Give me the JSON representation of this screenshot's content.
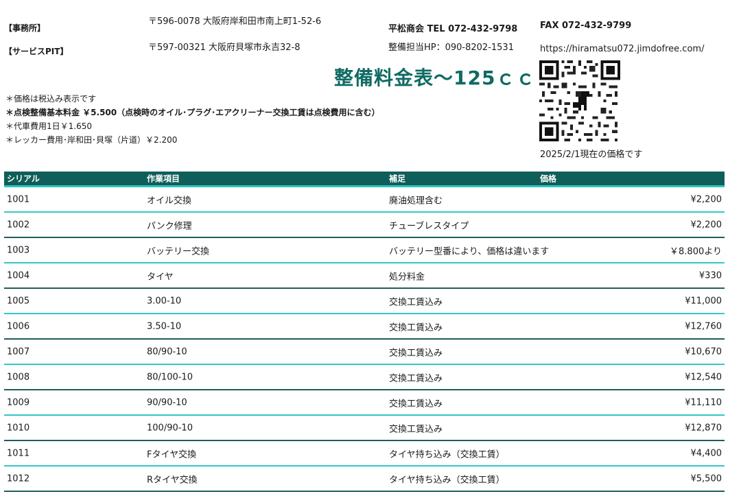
{
  "header": {
    "office_label": "【事務所】",
    "office_address": "〒596-0078 大阪府岸和田市南上町1-52-6",
    "pit_label": "【サービスPIT】",
    "pit_address": "〒597-00321 大阪府貝塚市永吉32-8",
    "company_tel": "平松商会 TEL 072-432-9798",
    "fax": "FAX 072-432-9799",
    "mechanic_hp": "整備担当HP：090-8202-1531",
    "website": "https://hiramatsu072.jimdofree.com/"
  },
  "title": "整備料金表～125ｃｃ",
  "notes": [
    "＊価格は税込み表示です",
    "＊点検整備基本料金 ￥5.500（点検時のオイル･プラグ･エアクリーナー交換工賃は点検費用に含む）",
    "＊代車費用1日￥1.650",
    "＊レッカー費用･岸和田･貝塚（片道）￥2.200"
  ],
  "as_of": "2025/2/1現在の価格です",
  "qr_icon": "qr-code-icon",
  "colors": {
    "accent": "#0f6b63",
    "header_bg": "#0f5e59",
    "row_line_dark": "#1f5c59",
    "row_line_light": "#33c7c6"
  },
  "table": {
    "columns": [
      "シリアル",
      "作業項目",
      "補足",
      "価格"
    ],
    "rows": [
      {
        "serial": "1001",
        "item": "オイル交換",
        "note": "廃油処理含む",
        "price": "¥2,200"
      },
      {
        "serial": "1002",
        "item": "パンク修理",
        "note": "チューブレスタイプ",
        "price": "¥2,200"
      },
      {
        "serial": "1003",
        "item": "バッテリー交換",
        "note": "バッテリー型番により、価格は違います",
        "price": "￥8.800より"
      },
      {
        "serial": "1004",
        "item": "タイヤ",
        "note": "処分料金",
        "price": "¥330"
      },
      {
        "serial": "1005",
        "item": "3.00-10",
        "note": "交換工賃込み",
        "price": "¥11,000"
      },
      {
        "serial": "1006",
        "item": "3.50-10",
        "note": "交換工賃込み",
        "price": "¥12,760"
      },
      {
        "serial": "1007",
        "item": "80/90-10",
        "note": "交換工賃込み",
        "price": "¥10,670"
      },
      {
        "serial": "1008",
        "item": "80/100-10",
        "note": "交換工賃込み",
        "price": "¥12,540"
      },
      {
        "serial": "1009",
        "item": "90/90-10",
        "note": "交換工賃込み",
        "price": "¥11,110"
      },
      {
        "serial": "1010",
        "item": "100/90-10",
        "note": "交換工賃込み",
        "price": "¥12,870"
      },
      {
        "serial": "1011",
        "item": "Fタイヤ交換",
        "note": "タイヤ持ち込み（交換工賃）",
        "price": "¥4,400"
      },
      {
        "serial": "1012",
        "item": "Rタイヤ交換",
        "note": "タイヤ持ち込み（交換工賃）",
        "price": "¥5,500"
      }
    ]
  }
}
